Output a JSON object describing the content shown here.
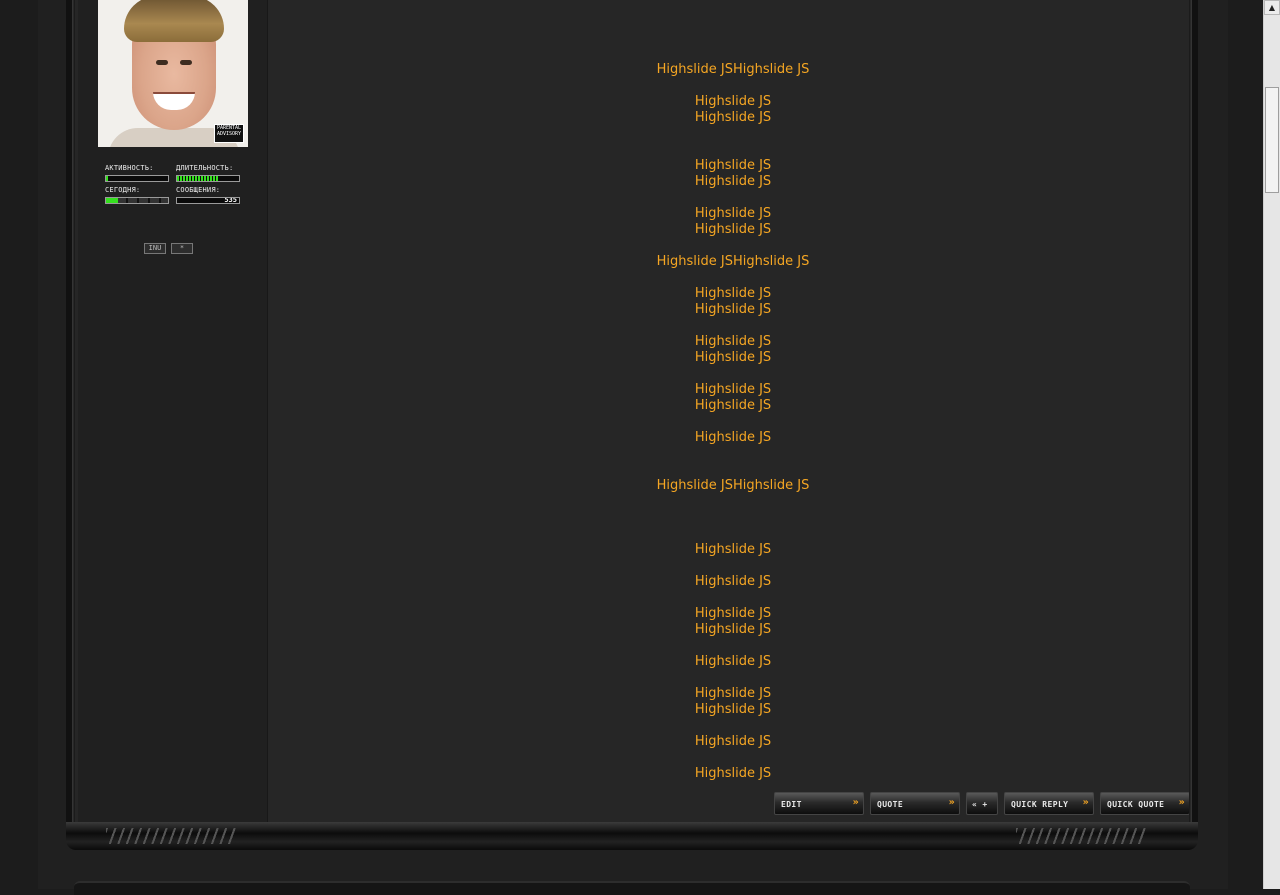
{
  "sidebar": {
    "avatar_advisory": "PARENTAL ADVISORY",
    "stats": {
      "activity_label": "АКТИВНОСТЬ:",
      "duration_label": "ДЛИТЕЛЬНОСТЬ:",
      "today_label": "СЕГОДНЯ:",
      "messages_label": "СООБЩЕНИЯ:",
      "messages_count": "535",
      "activity_level": 0.03,
      "duration_level": 0.68,
      "today_level": 0.2
    },
    "buttons": {
      "info": "INU",
      "star": "*"
    }
  },
  "post": {
    "lines": [
      "Highslide JSHighslide JS",
      "Highslide JS",
      "Highslide JS",
      "Highslide JS",
      "Highslide JS",
      "Highslide JS",
      "Highslide JS",
      "Highslide JSHighslide JS",
      "Highslide JS",
      "Highslide JS",
      "Highslide JS",
      "Highslide JS",
      "Highslide JS",
      "Highslide JS",
      "Highslide JS",
      "Highslide JSHighslide JS",
      "Highslide JS",
      "Highslide JS",
      "Highslide JS",
      "Highslide JS",
      "Highslide JS",
      "Highslide JS",
      "Highslide JS",
      "Highslide JS",
      "Highslide JS"
    ],
    "buttons": {
      "edit": "EDIT",
      "quote": "QUOTE",
      "multiquote": "« +",
      "quick_reply": "QUICK REPLY",
      "quick_quote": "QUICK QUOTE"
    }
  },
  "colors": {
    "link": "#f5a623",
    "bar_green": "#35e01f",
    "bar_red": "#e03a1f"
  }
}
